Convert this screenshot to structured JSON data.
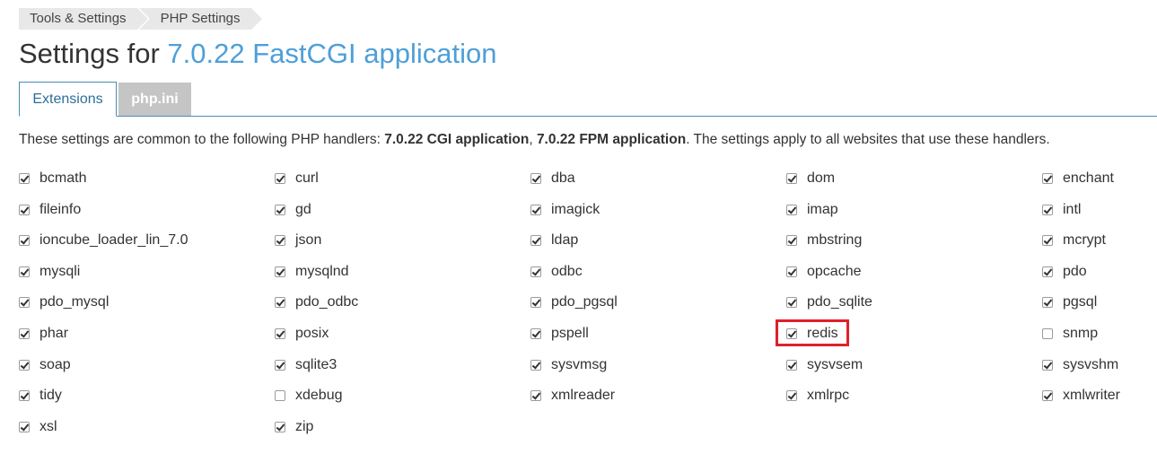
{
  "breadcrumb": [
    {
      "label": "Tools & Settings"
    },
    {
      "label": "PHP Settings"
    }
  ],
  "title": {
    "prefix": "Settings for ",
    "accent": "7.0.22 FastCGI application"
  },
  "tabs": [
    {
      "label": "Extensions",
      "active": true
    },
    {
      "label": "php.ini",
      "active": false
    }
  ],
  "description": {
    "part1": "These settings are common to the following PHP handlers: ",
    "handler1": "7.0.22 CGI application",
    "sep": ", ",
    "handler2": "7.0.22 FPM application",
    "part2": ". The settings apply to all websites that use these handlers."
  },
  "highlight_color": "#e0202a",
  "accent_color": "#4e9fd8",
  "extensions": [
    {
      "name": "bcmath",
      "checked": true
    },
    {
      "name": "curl",
      "checked": true
    },
    {
      "name": "dba",
      "checked": true
    },
    {
      "name": "dom",
      "checked": true
    },
    {
      "name": "enchant",
      "checked": true
    },
    {
      "name": "fileinfo",
      "checked": true
    },
    {
      "name": "gd",
      "checked": true
    },
    {
      "name": "imagick",
      "checked": true
    },
    {
      "name": "imap",
      "checked": true
    },
    {
      "name": "intl",
      "checked": true
    },
    {
      "name": "ioncube_loader_lin_7.0",
      "checked": true
    },
    {
      "name": "json",
      "checked": true
    },
    {
      "name": "ldap",
      "checked": true
    },
    {
      "name": "mbstring",
      "checked": true
    },
    {
      "name": "mcrypt",
      "checked": true
    },
    {
      "name": "mysqli",
      "checked": true
    },
    {
      "name": "mysqlnd",
      "checked": true
    },
    {
      "name": "odbc",
      "checked": true
    },
    {
      "name": "opcache",
      "checked": true
    },
    {
      "name": "pdo",
      "checked": true
    },
    {
      "name": "pdo_mysql",
      "checked": true
    },
    {
      "name": "pdo_odbc",
      "checked": true
    },
    {
      "name": "pdo_pgsql",
      "checked": true
    },
    {
      "name": "pdo_sqlite",
      "checked": true
    },
    {
      "name": "pgsql",
      "checked": true
    },
    {
      "name": "phar",
      "checked": true
    },
    {
      "name": "posix",
      "checked": true
    },
    {
      "name": "pspell",
      "checked": true
    },
    {
      "name": "redis",
      "checked": true,
      "highlighted": true
    },
    {
      "name": "snmp",
      "checked": false
    },
    {
      "name": "soap",
      "checked": true
    },
    {
      "name": "sqlite3",
      "checked": true
    },
    {
      "name": "sysvmsg",
      "checked": true
    },
    {
      "name": "sysvsem",
      "checked": true
    },
    {
      "name": "sysvshm",
      "checked": true
    },
    {
      "name": "tidy",
      "checked": true
    },
    {
      "name": "xdebug",
      "checked": false
    },
    {
      "name": "xmlreader",
      "checked": true
    },
    {
      "name": "xmlrpc",
      "checked": true
    },
    {
      "name": "xmlwriter",
      "checked": true
    },
    {
      "name": "xsl",
      "checked": true
    },
    {
      "name": "zip",
      "checked": true
    }
  ]
}
